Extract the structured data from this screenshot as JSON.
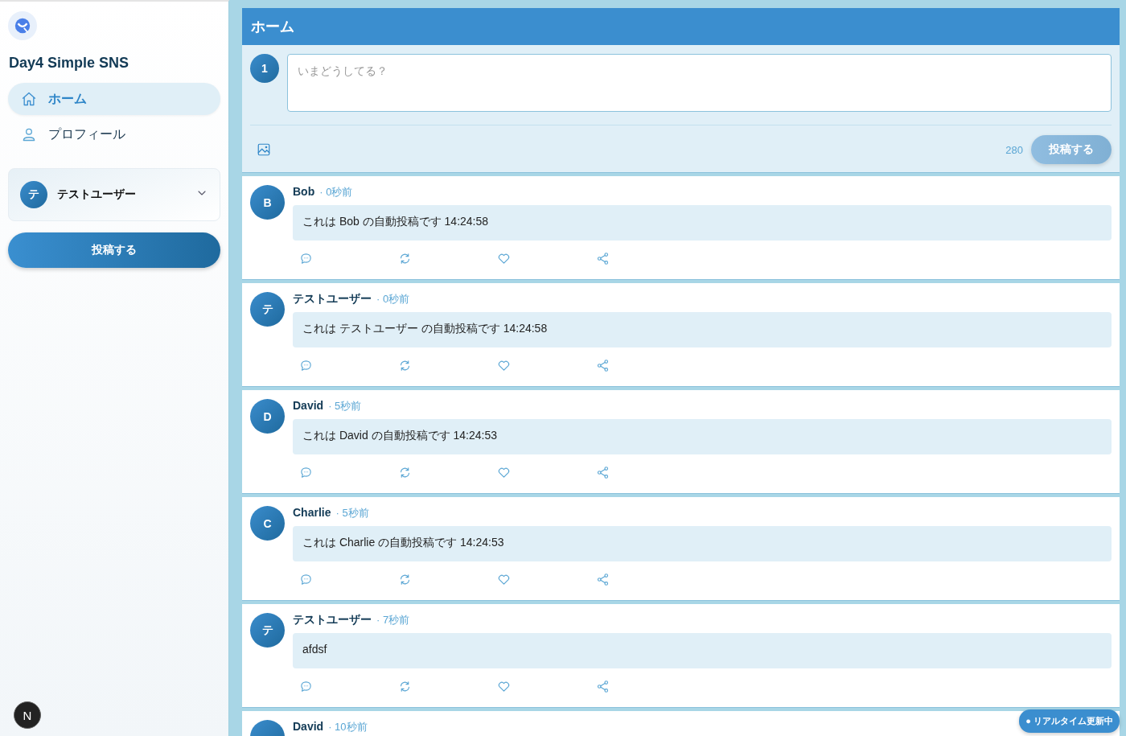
{
  "sidebar": {
    "app_title": "Day4 Simple SNS",
    "nav": [
      {
        "label": "ホーム",
        "selected": true
      },
      {
        "label": "プロフィール",
        "selected": false
      }
    ],
    "account": {
      "avatar": "テ",
      "name": "テストユーザー"
    },
    "post_button": "投稿する"
  },
  "header": {
    "title": "ホーム"
  },
  "composer": {
    "avatar": "1",
    "placeholder": "いまどうしてる？",
    "char_count": "280",
    "submit": {
      "label": "投稿する",
      "disabled": true
    }
  },
  "posts": [
    {
      "avatar": "B",
      "name": "Bob",
      "time": "· 0秒前",
      "body": "これは Bob の自動投稿です 14:24:58"
    },
    {
      "avatar": "テ",
      "name": "テストユーザー",
      "time": "· 0秒前",
      "body": "これは テストユーザー の自動投稿です 14:24:58"
    },
    {
      "avatar": "D",
      "name": "David",
      "time": "· 5秒前",
      "body": "これは David の自動投稿です 14:24:53"
    },
    {
      "avatar": "C",
      "name": "Charlie",
      "time": "· 5秒前",
      "body": "これは Charlie の自動投稿です 14:24:53"
    },
    {
      "avatar": "テ",
      "name": "テストユーザー",
      "time": "· 7秒前",
      "body": "afdsf"
    },
    {
      "name": "David",
      "time": "· 10秒前"
    }
  ],
  "realtime_badge": "● リアルタイム更新中",
  "dev_badge": "N"
}
